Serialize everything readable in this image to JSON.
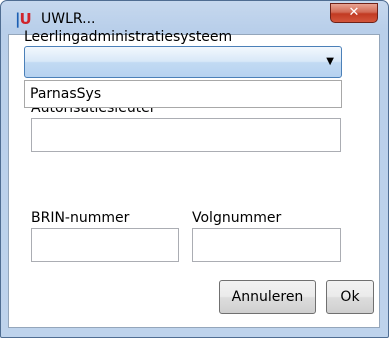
{
  "window": {
    "title": "UWLR...",
    "icon_text_left": "|",
    "icon_text_right": "U",
    "close_glyph": "✕"
  },
  "form": {
    "system_label": "Leerlingadministratiesysteem",
    "system_value": "",
    "dropdown_options": [
      "ParnasSys"
    ],
    "auth_label": "Autorisatiesleutel",
    "auth_value": "",
    "brin_label": "BRIN-nummer",
    "brin_value": "",
    "volg_label": "Volgnummer",
    "volg_value": ""
  },
  "buttons": {
    "cancel_label": "Annuleren",
    "ok_label": "Ok"
  },
  "icons": {
    "dropdown_arrow": "▼"
  }
}
